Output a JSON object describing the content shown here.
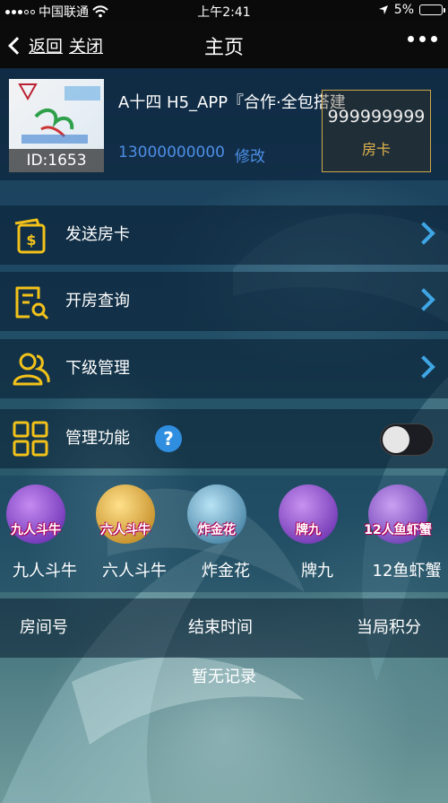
{
  "status_bar": {
    "carrier": "中国联通",
    "time": "上午2:41",
    "battery": "5%",
    "battery_level": 0.05
  },
  "nav": {
    "back_label": "返回",
    "close_label": "关闭",
    "title": "主页"
  },
  "profile": {
    "id_label": "ID:1653",
    "name": "A十四 H5_APP『合作·全包搭建",
    "phone": "13000000000",
    "edit_label": "修改",
    "card_count": "999999999",
    "card_label": "房卡"
  },
  "menu": {
    "send_card": "发送房卡",
    "room_query": "开房查询",
    "sub_manage": "下级管理",
    "admin_function": "管理功能",
    "help_symbol": "?",
    "admin_toggle_on": false
  },
  "games": [
    {
      "name": "九人斗牛",
      "tag": "九人斗牛",
      "color": "#7a3fd1"
    },
    {
      "name": "六人斗牛",
      "tag": "六人斗牛",
      "color": "#d19a1f"
    },
    {
      "name": "炸金花",
      "tag": "炸金花",
      "color": "#3a7fa8"
    },
    {
      "name": "牌九",
      "tag": "牌九",
      "color": "#8a3fc9"
    },
    {
      "name": "12鱼虾蟹",
      "tag": "12人鱼虾蟹",
      "color": "#7b41c8"
    }
  ],
  "records": {
    "col_room": "房间号",
    "col_end_time": "结束时间",
    "col_score": "当局积分",
    "empty_text": "暂无记录"
  },
  "colors": {
    "accent_blue": "#4d8fe6",
    "arrow_blue": "#3fa6e6",
    "gold": "#e2b44c",
    "icon_yellow": "#f2c21b"
  }
}
